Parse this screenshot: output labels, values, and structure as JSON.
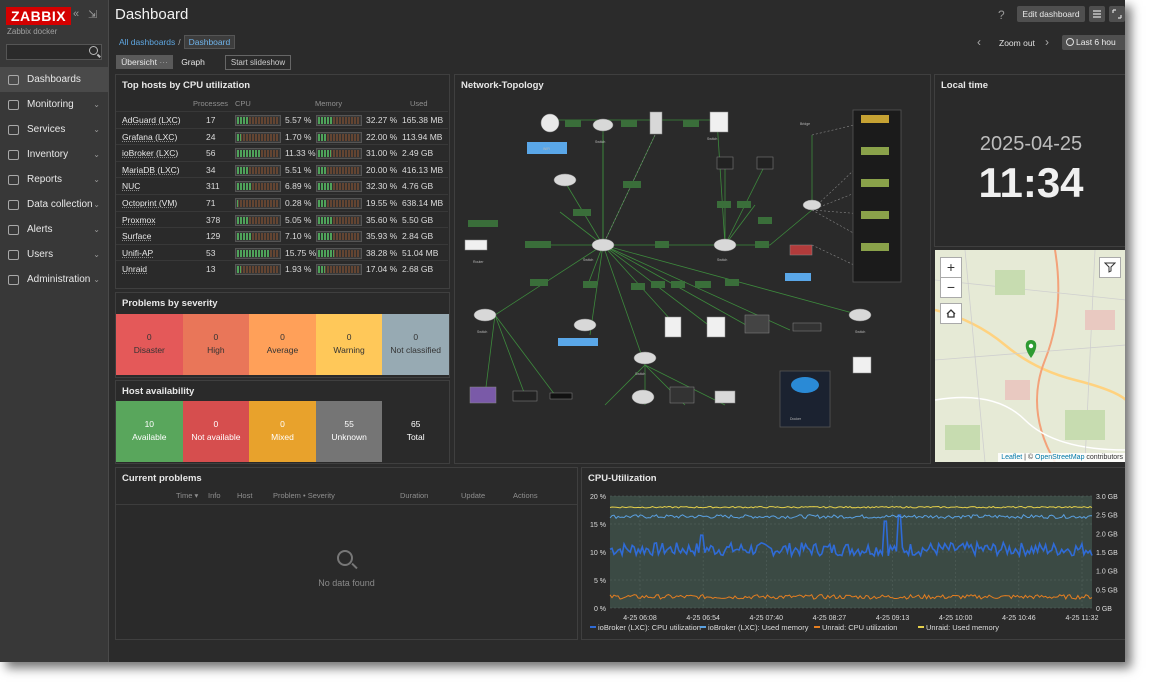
{
  "app": {
    "logo": "ZABBIX",
    "instance": "Zabbix docker"
  },
  "sidebar": {
    "items": [
      {
        "label": "Dashboards",
        "icon": "dashboard-icon",
        "active": true
      },
      {
        "label": "Monitoring",
        "icon": "monitor-icon"
      },
      {
        "label": "Services",
        "icon": "services-icon"
      },
      {
        "label": "Inventory",
        "icon": "inventory-icon"
      },
      {
        "label": "Reports",
        "icon": "reports-icon"
      },
      {
        "label": "Data collection",
        "icon": "data-collection-icon"
      },
      {
        "label": "Alerts",
        "icon": "bell-icon"
      },
      {
        "label": "Users",
        "icon": "user-icon"
      },
      {
        "label": "Administration",
        "icon": "gear-icon"
      }
    ]
  },
  "header": {
    "title": "Dashboard",
    "help": "?",
    "edit_button": "Edit dashboard"
  },
  "breadcrumb": {
    "all": "All dashboards",
    "separator": "/",
    "current": "Dashboard"
  },
  "timebar": {
    "zoom_out": "Zoom out",
    "range": "Last 6 hou"
  },
  "tabs": [
    {
      "label": "Übersicht",
      "dots": "···"
    },
    {
      "label": "Graph"
    }
  ],
  "slideshow_button": "Start slideshow",
  "top_hosts": {
    "title": "Top hosts by CPU utilization",
    "columns": [
      "Processes",
      "CPU",
      "Memory",
      "Used"
    ],
    "rows": [
      {
        "host": "AdGuard (LXC)",
        "processes": "17",
        "cpu": "5.57 %",
        "mem": "32.27 %",
        "used": "165.38 MB",
        "cpu_v": 5.57,
        "mem_v": 32.27
      },
      {
        "host": "Grafana (LXC)",
        "processes": "24",
        "cpu": "1.70 %",
        "mem": "22.00 %",
        "used": "113.94 MB",
        "cpu_v": 1.7,
        "mem_v": 22.0
      },
      {
        "host": "ioBroker (LXC)",
        "processes": "56",
        "cpu": "11.33 %",
        "mem": "31.00 %",
        "used": "2.49 GB",
        "cpu_v": 11.33,
        "mem_v": 31.0
      },
      {
        "host": "MariaDB (LXC)",
        "processes": "34",
        "cpu": "5.51 %",
        "mem": "20.00 %",
        "used": "416.13 MB",
        "cpu_v": 5.51,
        "mem_v": 20.0
      },
      {
        "host": "NUC",
        "processes": "311",
        "cpu": "6.89 %",
        "mem": "32.30 %",
        "used": "4.76 GB",
        "cpu_v": 6.89,
        "mem_v": 32.3
      },
      {
        "host": "Octoprint (VM)",
        "processes": "71",
        "cpu": "0.28 %",
        "mem": "19.55 %",
        "used": "638.14 MB",
        "cpu_v": 0.28,
        "mem_v": 19.55
      },
      {
        "host": "Proxmox",
        "processes": "378",
        "cpu": "5.05 %",
        "mem": "35.60 %",
        "used": "5.50 GB",
        "cpu_v": 5.05,
        "mem_v": 35.6
      },
      {
        "host": "Surface",
        "processes": "129",
        "cpu": "7.10 %",
        "mem": "35.93 %",
        "used": "2.84 GB",
        "cpu_v": 7.1,
        "mem_v": 35.93
      },
      {
        "host": "Unifi-AP",
        "processes": "53",
        "cpu": "15.75 %",
        "mem": "38.28 %",
        "used": "51.04 MB",
        "cpu_v": 15.75,
        "mem_v": 38.28
      },
      {
        "host": "Unraid",
        "processes": "13",
        "cpu": "1.93 %",
        "mem": "17.04 %",
        "used": "2.68 GB",
        "cpu_v": 1.93,
        "mem_v": 17.04
      }
    ]
  },
  "problems_by_severity": {
    "title": "Problems by severity",
    "items": [
      {
        "count": "0",
        "label": "Disaster",
        "color": "#e45959"
      },
      {
        "count": "0",
        "label": "High",
        "color": "#e97659"
      },
      {
        "count": "0",
        "label": "Average",
        "color": "#ffa059"
      },
      {
        "count": "0",
        "label": "Warning",
        "color": "#ffc859"
      },
      {
        "count": "0",
        "label": "Not classified",
        "color": "#97aab3"
      }
    ]
  },
  "host_availability": {
    "title": "Host availability",
    "items": [
      {
        "count": "10",
        "label": "Available",
        "color": "#59a65c"
      },
      {
        "count": "0",
        "label": "Not available",
        "color": "#d64e4e"
      },
      {
        "count": "0",
        "label": "Mixed",
        "color": "#e8a22c"
      },
      {
        "count": "55",
        "label": "Unknown",
        "color": "#757575"
      },
      {
        "count": "65",
        "label": "Total",
        "color": "#2a2a2a"
      }
    ]
  },
  "network_topology": {
    "title": "Network-Topology"
  },
  "local_time": {
    "title": "Local time",
    "date": "2025-04-25",
    "time": "11:34"
  },
  "map": {
    "zoom_in": "+",
    "zoom_out": "−",
    "attribution_leaflet": "Leaflet",
    "attribution_sep": " | © ",
    "attribution_osm": "OpenStreetMap",
    "attribution_tail": " contributors"
  },
  "current_problems": {
    "title": "Current problems",
    "columns": [
      "Time ▾",
      "Info",
      "Host",
      "Problem • Severity",
      "Duration",
      "Update",
      "Actions"
    ],
    "empty": "No data found"
  },
  "cpu_chart": {
    "title": "CPU-Utilization",
    "legend": [
      {
        "label": "ioBroker (LXC): CPU utilization",
        "color": "#2f6bd6"
      },
      {
        "label": "ioBroker (LXC): Used memory",
        "color": "#5aa0e0"
      },
      {
        "label": "Unraid: CPU utilization",
        "color": "#e57e20"
      },
      {
        "label": "Unraid: Used memory",
        "color": "#e5d04a"
      }
    ]
  },
  "chart_data": {
    "type": "line",
    "title": "CPU-Utilization",
    "x": [
      "4-25 06:08",
      "4-25 06:54",
      "4-25 07:40",
      "4-25 08:27",
      "4-25 09:13",
      "4-25 10:00",
      "4-25 10:46",
      "4-25 11:32"
    ],
    "y_left_ticks": [
      "20 %",
      "15 %",
      "10 %",
      "5 %",
      "0 %"
    ],
    "y_right_ticks": [
      "3.0 GB",
      "2.5 GB",
      "2.0 GB",
      "1.5 GB",
      "1.0 GB",
      "0.5 GB",
      "0 GB"
    ],
    "ylim_left": [
      0,
      20
    ],
    "ylim_right": [
      0,
      3.0
    ],
    "series": [
      {
        "name": "ioBroker (LXC): CPU utilization",
        "axis": "left",
        "base": 10.5,
        "noise": 1.2,
        "spikes": [
          [
            0.57,
            15.5
          ],
          [
            0.6,
            16.6
          ],
          [
            0.19,
            13.0
          ]
        ]
      },
      {
        "name": "ioBroker (LXC): Used memory",
        "axis": "right",
        "base": 2.45,
        "noise": 0.05
      },
      {
        "name": "Unraid: CPU utilization",
        "axis": "left",
        "base": 2.0,
        "noise": 0.4
      },
      {
        "name": "Unraid: Used memory",
        "axis": "right",
        "base": 2.7,
        "noise": 0.02
      }
    ]
  }
}
